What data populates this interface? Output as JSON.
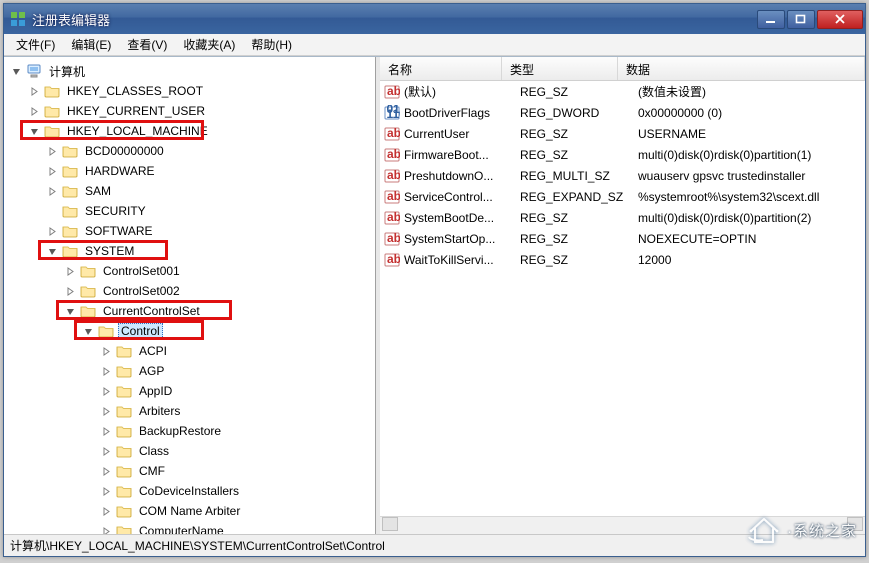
{
  "window": {
    "title": "注册表编辑器"
  },
  "menu": [
    "文件(F)",
    "编辑(E)",
    "查看(V)",
    "收藏夹(A)",
    "帮助(H)"
  ],
  "tree": [
    {
      "depth": 0,
      "expand": "open",
      "icon": "computer",
      "label": "计算机"
    },
    {
      "depth": 1,
      "expand": "closed",
      "icon": "folder",
      "label": "HKEY_CLASSES_ROOT"
    },
    {
      "depth": 1,
      "expand": "closed",
      "icon": "folder",
      "label": "HKEY_CURRENT_USER"
    },
    {
      "depth": 1,
      "expand": "open",
      "icon": "folder",
      "label": "HKEY_LOCAL_MACHINE",
      "hl": true
    },
    {
      "depth": 2,
      "expand": "closed",
      "icon": "folder",
      "label": "BCD00000000"
    },
    {
      "depth": 2,
      "expand": "closed",
      "icon": "folder",
      "label": "HARDWARE"
    },
    {
      "depth": 2,
      "expand": "closed",
      "icon": "folder",
      "label": "SAM"
    },
    {
      "depth": 2,
      "expand": "none",
      "icon": "folder",
      "label": "SECURITY"
    },
    {
      "depth": 2,
      "expand": "closed",
      "icon": "folder",
      "label": "SOFTWARE"
    },
    {
      "depth": 2,
      "expand": "open",
      "icon": "folder",
      "label": "SYSTEM",
      "hl": true
    },
    {
      "depth": 3,
      "expand": "closed",
      "icon": "folder",
      "label": "ControlSet001"
    },
    {
      "depth": 3,
      "expand": "closed",
      "icon": "folder",
      "label": "ControlSet002"
    },
    {
      "depth": 3,
      "expand": "open",
      "icon": "folder",
      "label": "CurrentControlSet",
      "hl": true
    },
    {
      "depth": 4,
      "expand": "open",
      "icon": "folder",
      "label": "Control",
      "hl": true,
      "sel": true
    },
    {
      "depth": 5,
      "expand": "closed",
      "icon": "folder",
      "label": "ACPI"
    },
    {
      "depth": 5,
      "expand": "closed",
      "icon": "folder",
      "label": "AGP"
    },
    {
      "depth": 5,
      "expand": "closed",
      "icon": "folder",
      "label": "AppID"
    },
    {
      "depth": 5,
      "expand": "closed",
      "icon": "folder",
      "label": "Arbiters"
    },
    {
      "depth": 5,
      "expand": "closed",
      "icon": "folder",
      "label": "BackupRestore"
    },
    {
      "depth": 5,
      "expand": "closed",
      "icon": "folder",
      "label": "Class"
    },
    {
      "depth": 5,
      "expand": "closed",
      "icon": "folder",
      "label": "CMF"
    },
    {
      "depth": 5,
      "expand": "closed",
      "icon": "folder",
      "label": "CoDeviceInstallers"
    },
    {
      "depth": 5,
      "expand": "closed",
      "icon": "folder",
      "label": "COM Name Arbiter"
    },
    {
      "depth": 5,
      "expand": "closed",
      "icon": "folder",
      "label": "ComputerName"
    }
  ],
  "list_columns": {
    "name": "名称",
    "type": "类型",
    "data": "数据"
  },
  "list_rows": [
    {
      "kind": "sz",
      "name": "(默认)",
      "type": "REG_SZ",
      "data": "(数值未设置)"
    },
    {
      "kind": "bin",
      "name": "BootDriverFlags",
      "type": "REG_DWORD",
      "data": "0x00000000 (0)"
    },
    {
      "kind": "sz",
      "name": "CurrentUser",
      "type": "REG_SZ",
      "data": "USERNAME"
    },
    {
      "kind": "sz",
      "name": "FirmwareBoot...",
      "type": "REG_SZ",
      "data": "multi(0)disk(0)rdisk(0)partition(1)"
    },
    {
      "kind": "sz",
      "name": "PreshutdownO...",
      "type": "REG_MULTI_SZ",
      "data": "wuauserv gpsvc trustedinstaller"
    },
    {
      "kind": "sz",
      "name": "ServiceControl...",
      "type": "REG_EXPAND_SZ",
      "data": "%systemroot%\\system32\\scext.dll"
    },
    {
      "kind": "sz",
      "name": "SystemBootDe...",
      "type": "REG_SZ",
      "data": "multi(0)disk(0)rdisk(0)partition(2)"
    },
    {
      "kind": "sz",
      "name": "SystemStartOp...",
      "type": "REG_SZ",
      "data": "   NOEXECUTE=OPTIN"
    },
    {
      "kind": "sz",
      "name": "WaitToKillServi...",
      "type": "REG_SZ",
      "data": "12000"
    }
  ],
  "statusbar": "计算机\\HKEY_LOCAL_MACHINE\\SYSTEM\\CurrentControlSet\\Control",
  "watermark": "·系统之家"
}
